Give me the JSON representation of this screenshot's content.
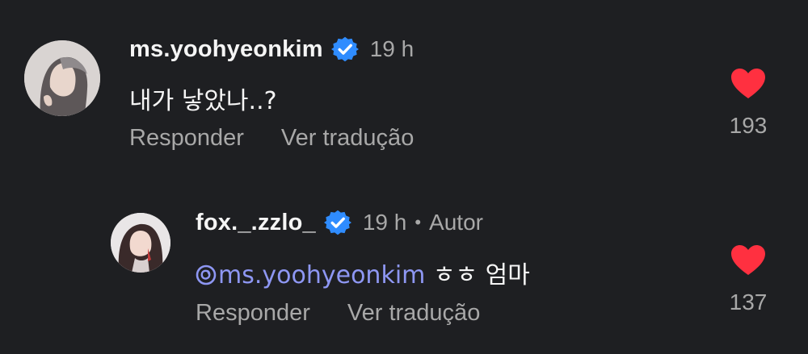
{
  "comments": [
    {
      "username": "ms.yoohyeonkim",
      "verified": true,
      "time": "19 h",
      "text": "내가 낳았나..?",
      "reply_label": "Responder",
      "translate_label": "Ver tradução",
      "like_count": "193",
      "heart_color": "#ff3040"
    }
  ],
  "reply": {
    "username": "fox._.zzlo_",
    "verified": true,
    "time": "19 h",
    "separator": "•",
    "author_label": "Autor",
    "mention": "ms.yoohyeonkim",
    "text": " ㅎㅎ 엄마",
    "reply_label": "Responder",
    "translate_label": "Ver tradução",
    "like_count": "137",
    "heart_color": "#ff3040"
  },
  "colors": {
    "background": "#1e1f22",
    "primary_text": "#f5f5f5",
    "secondary_text": "#a8a8a8",
    "verified_badge": "#2f8cff",
    "mention": "#8e97f3",
    "like": "#ff3040"
  },
  "icons": {
    "verified": "verified-badge-icon",
    "like": "heart-icon",
    "mention": "threads-mention-icon"
  }
}
